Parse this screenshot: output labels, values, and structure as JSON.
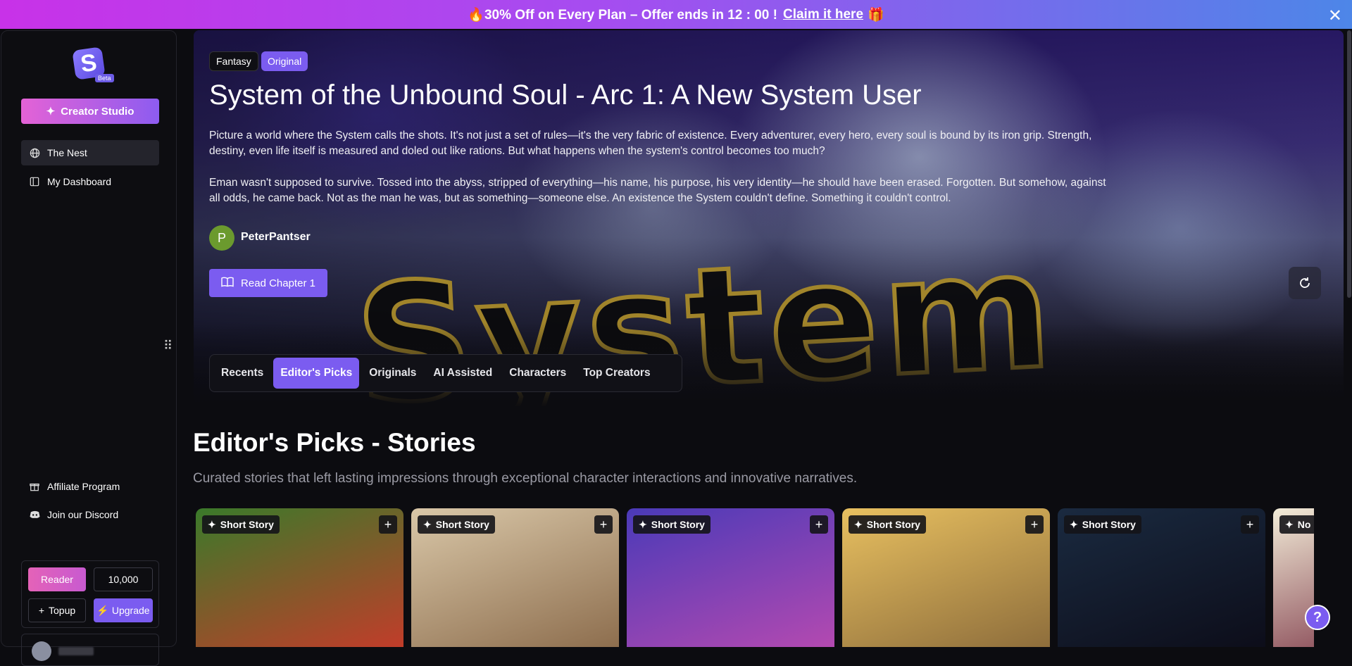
{
  "promo": {
    "text": "🔥30% Off on Every Plan – Offer ends in 12 : 00 !",
    "link": "Claim it here",
    "gift": "🎁",
    "close": "✕"
  },
  "sidebar": {
    "logo_letter": "S",
    "beta": "Beta",
    "creator_studio": "Creator Studio",
    "nav": [
      {
        "label": "The Nest",
        "icon": "globe-icon"
      },
      {
        "label": "My Dashboard",
        "icon": "dashboard-icon"
      }
    ],
    "affiliate": "Affiliate Program",
    "discord": "Join our Discord",
    "reader": "Reader",
    "credits": "10,000",
    "topup": "Topup",
    "upgrade": "Upgrade"
  },
  "hero": {
    "tags": [
      "Fantasy",
      "Original"
    ],
    "title": "System of the Unbound Soul - Arc 1: A New System User",
    "desc1": "Picture a world where the System calls the shots. It's not just a set of rules—it's the very fabric of existence. Every adventurer, every hero, every soul is bound by its iron grip. Strength, destiny, even life itself is measured and doled out like rations. But what happens when the system's control becomes too much?",
    "desc2": "Eman wasn't supposed to survive. Tossed into the abyss, stripped of everything—his name, his purpose, his very identity—he should have been erased. Forgotten. But somehow, against all odds, he came back. Not as the man he was, but as something—someone else. An existence the System couldn't define. Something it couldn't control.",
    "author_initial": "P",
    "author": "PeterPantser",
    "read_button": "Read Chapter 1"
  },
  "tabs": [
    "Recents",
    "Editor's Picks",
    "Originals",
    "AI Assisted",
    "Characters",
    "Top Creators"
  ],
  "active_tab": "Editor's Picks",
  "section": {
    "title": "Editor's Picks - Stories",
    "subtitle": "Curated stories that left lasting impressions through exceptional character interactions and innovative narratives."
  },
  "cards": [
    {
      "label": "Short Story",
      "colors": [
        "#3a7a2a",
        "#c73a2a"
      ]
    },
    {
      "label": "Short Story",
      "colors": [
        "#d9c7a8",
        "#8a6a4a"
      ]
    },
    {
      "label": "Short Story",
      "colors": [
        "#4a3ab8",
        "#b84ab0"
      ]
    },
    {
      "label": "Short Story",
      "colors": [
        "#e8c060",
        "#8a6a3a"
      ]
    },
    {
      "label": "Short Story",
      "colors": [
        "#1a2a40",
        "#0c0c18"
      ]
    },
    {
      "label": "No",
      "colors": [
        "#f2ecd8",
        "#6a1a30"
      ]
    }
  ],
  "help": "?"
}
